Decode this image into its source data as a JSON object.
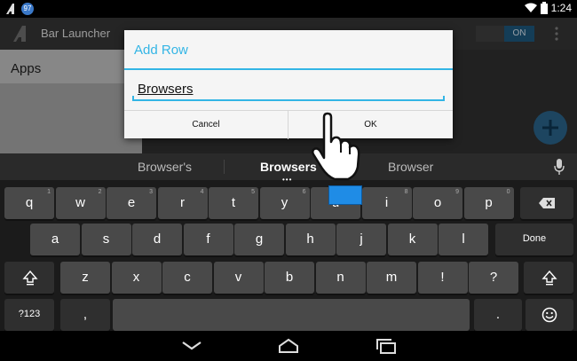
{
  "status_bar": {
    "badge": "97",
    "time": "1:24"
  },
  "action_bar": {
    "title": "Bar Launcher",
    "toggle_label": "ON"
  },
  "apps_panel": {
    "label": "Apps"
  },
  "dialog": {
    "title": "Add Row",
    "input_value": "Browsers",
    "cancel_label": "Cancel",
    "ok_label": "OK"
  },
  "keyboard": {
    "suggestions": [
      "Browser's",
      "Browsers",
      "Browser"
    ],
    "rows": [
      [
        {
          "label": "q",
          "sub": "1"
        },
        {
          "label": "w",
          "sub": "2"
        },
        {
          "label": "e",
          "sub": "3"
        },
        {
          "label": "r",
          "sub": "4"
        },
        {
          "label": "t",
          "sub": "5"
        },
        {
          "label": "y",
          "sub": "6"
        },
        {
          "label": "u",
          "sub": "7"
        },
        {
          "label": "i",
          "sub": "8"
        },
        {
          "label": "o",
          "sub": "9"
        },
        {
          "label": "p",
          "sub": "0"
        }
      ],
      [
        {
          "label": "a"
        },
        {
          "label": "s"
        },
        {
          "label": "d"
        },
        {
          "label": "f"
        },
        {
          "label": "g"
        },
        {
          "label": "h"
        },
        {
          "label": "j"
        },
        {
          "label": "k"
        },
        {
          "label": "l"
        }
      ],
      [
        {
          "label": "z"
        },
        {
          "label": "x"
        },
        {
          "label": "c"
        },
        {
          "label": "v"
        },
        {
          "label": "b"
        },
        {
          "label": "n"
        },
        {
          "label": "m"
        },
        {
          "label": "!"
        },
        {
          "label": "?"
        }
      ]
    ],
    "done_label": "Done",
    "symbols_label": "?123",
    "comma_label": ",",
    "period_label": ".",
    "icons": {
      "backspace": "backspace-icon",
      "shift": "shift-icon",
      "emoji": "emoji-icon",
      "mic": "microphone-icon"
    }
  },
  "colors": {
    "accent": "#33b5e5",
    "touch": "#1f8ce6"
  }
}
